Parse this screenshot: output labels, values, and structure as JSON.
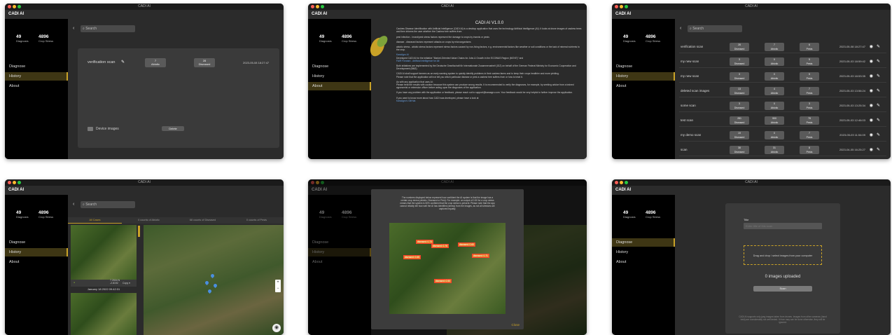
{
  "window_title": "CADI AI",
  "app_name": "CADI AI",
  "stats": {
    "diagnosis_count": "49",
    "diagnosis_label": "Diagnosis",
    "stress_count": "4896",
    "stress_label": "Crop Stress"
  },
  "nav": {
    "diagnose": "Diagnose",
    "history": "History",
    "about": "About"
  },
  "search_placeholder": "Search",
  "panel1": {
    "scan_name": "verification scan",
    "abiotic": "7\nAbiotic",
    "diseased": "28\nDiseased",
    "date": "2023-05-08 18:27:47",
    "device_images": "Device images",
    "delete": "Delete"
  },
  "panel2": {
    "heading": "CADI AI V1.0.0",
    "p1": "Cashew Disease Identification with Artificial Intelligence (CADI AI) is a desktop application that uses the technology Artificial Intelligence (AI). It looks at drone images of cashew trees and then informs the user whether the Cashew tree suffers from:",
    "p2": "pest infection - Insect/pest stress factors represent the damage to crops by insects or pests",
    "p3": "disease - diseased factors represent attacks on crops by microorganisms",
    "p4": "abiotic stress - abiotic stress factors represent stress factors caused by non-living factors, e.g. environmental factors like weather or soil conditions or the lack of mineral nutrients to the crop.",
    "l1": "KaraAgro AI",
    "p5": "Developed CADI AI for the initiative \"Market-Oriented Value Chains for Jobs & Growth in the ECOWAS Region (MOVE)\" and",
    "l2": "FAIR Forward - Artificial Intelligence for All",
    "p6": "Both initiatives are implemented by the Deutsche Gesellschaft für Internationale Zusammenarbeit (GIZ) on behalf of the German Federal Ministry for Economic Cooperation and Development (BMZ).",
    "p7": "CADI AI shall support farmers as an early warning system to quickly identify problems in their cashew farms and to keep their crops healthier and more yielding.",
    "p8": "Please note that the application will not tell you which particular disease or pest a cashew tree suffers from or how to treat it.",
    "p9": "As with any application that uses AI:",
    "p10": "Please treat the results with caution because this system can produce wrong results. It is recommended to verify the diagnoses, for example, by seeking advice from a trained agronomist or extension officer before acting upon the diagnoses of the application.",
    "p11": "If you have any problem with the application or feedback, please reach out to support@karaagro.com. Your feedback would be very helpful to further improve the application.",
    "p12": "If you want to know more about how CADI was developed, please have a look at",
    "l3": "KaraAgro's GitHub."
  },
  "panel3": {
    "rows": [
      {
        "name": "verification scan",
        "b1": "28\nDiseased",
        "b2": "7\nAbiotic",
        "b3": "6\nPests",
        "date": "2023-05-08 18:27:47"
      },
      {
        "name": "my new scan",
        "b1": "3\nDiseased",
        "b2": "0\nAbiotic",
        "b3": "5\nPests",
        "date": "2023-05-03 18:59:42"
      },
      {
        "name": "my new scan",
        "b1": "3\nDiseased",
        "b2": "0\nAbiotic",
        "b3": "5\nPests",
        "date": "2023-05-03 18:53:35"
      },
      {
        "name": "deleted scan images",
        "b1": "13\nDiseased",
        "b2": "4\nAbiotic",
        "b3": "7\nPests",
        "date": "2023-05-03 13:56:24"
      },
      {
        "name": "some scan",
        "b1": "3\nDiseased",
        "b2": "0\nAbiotic",
        "b3": "3\nPests",
        "date": "2023-05-03 13:25:34"
      },
      {
        "name": "test scan",
        "b1": "281\nDiseased",
        "b2": "900\nAbiotic",
        "b3": "78\nPests",
        "date": "2023-05-03 12:46:03"
      },
      {
        "name": "my demo scan",
        "b1": "19\nDiseased",
        "b2": "0\nAbiotic",
        "b3": "7\nPests",
        "date": "2023-05-03 11:54:09"
      },
      {
        "name": "scan",
        "b1": "38\nDiseased",
        "b2": "31\nAbiotic",
        "b3": "8\nPests",
        "date": "2023-04-05 16:25:27"
      }
    ]
  },
  "panel4": {
    "tabs": [
      "All Cases",
      "0 counts of Abiotic",
      "68 counts of Diseased",
      "0 counts of Pests"
    ],
    "image_date": "January 18 2022 09:42:31",
    "coords": "7.2534 N\n-2.8192",
    "copy_label": "Copy ▾"
  },
  "panel5": {
    "header_text": "The numbers displayed below represent how confident the AI system is that the image has a certain crop stress (abiotic, Diseased or Pest). For example: an output of 0.50 for a crop stress means that the system is 50% confident that the crop stress is present. Please note that the app cannot reliably tell how well the AI has identified (stress) from the images, as not all stresses are captured equally.",
    "labels": [
      "diseased: 0.73",
      "diseased: 0.76",
      "diseased: 0.60",
      "diseased: 0.71",
      "diseased: 0.65",
      "diseased: 0.50"
    ],
    "close": "Close"
  },
  "panel6": {
    "title_label": "Title",
    "title_placeholder": "Enter title of this scan",
    "drop_text": "Drag and drop / select images from your computer",
    "uploaded": "0 images uploaded",
    "scan_btn": "Scan",
    "footer": "CADI AI supports only jpeg images taken from drones. Images from other cameras (hand held) are considerably not well tested. It from may can be done otherwise, they will be ignored."
  }
}
